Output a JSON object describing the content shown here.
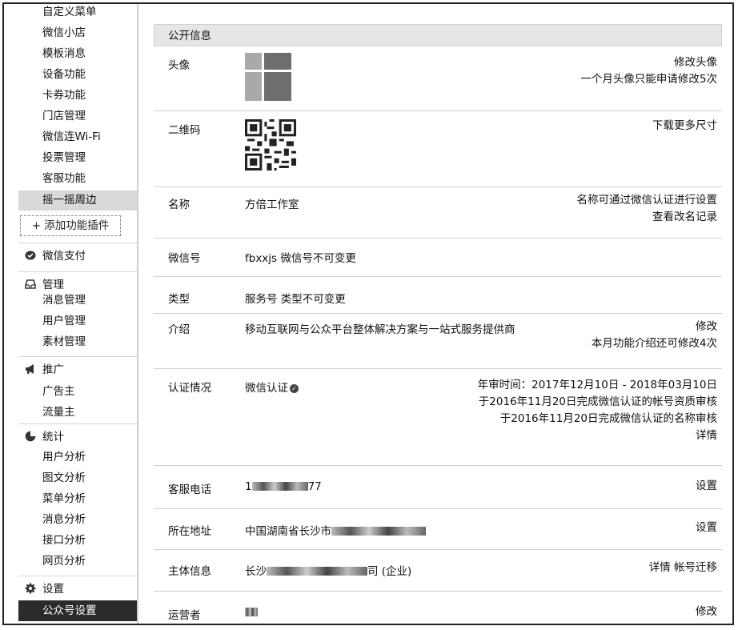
{
  "sidebar": {
    "top_items": [
      "自定义菜单",
      "微信小店",
      "模板消息",
      "设备功能",
      "卡券功能",
      "门店管理",
      "微信连Wi-Fi",
      "投票管理",
      "客服功能",
      "摇一摇周边"
    ],
    "add_plugin": "+ 添加功能插件",
    "pay": "微信支付",
    "manage": {
      "title": "管理",
      "items": [
        "消息管理",
        "用户管理",
        "素材管理"
      ]
    },
    "promote": {
      "title": "推广",
      "items": [
        "广告主",
        "流量主"
      ]
    },
    "stats": {
      "title": "统计",
      "items": [
        "用户分析",
        "图文分析",
        "菜单分析",
        "消息分析",
        "接口分析",
        "网页分析"
      ]
    },
    "settings": {
      "title": "设置",
      "items": [
        "公众号设置"
      ]
    }
  },
  "main": {
    "section_title": "公开信息",
    "avatar": {
      "label": "头像",
      "action": "修改头像",
      "note": "一个月头像只能申请修改5次"
    },
    "qrcode": {
      "label": "二维码",
      "action": "下载更多尺寸"
    },
    "name": {
      "label": "名称",
      "value": "方倍工作室",
      "action1": "名称可通过微信认证进行设置",
      "action2": "查看改名记录"
    },
    "wechat_id": {
      "label": "微信号",
      "value": "fbxxjs 微信号不可变更"
    },
    "type": {
      "label": "类型",
      "value": "服务号 类型不可变更"
    },
    "intro": {
      "label": "介绍",
      "value": "移动互联网与公众平台整体解决方案与一站式服务提供商",
      "action": "修改",
      "note": "本月功能介绍还可修改4次"
    },
    "verify": {
      "label": "认证情况",
      "value": "微信认证",
      "line1": "年审时间：2017年12月10日 - 2018年03月10日",
      "line2": "于2016年11月20日完成微信认证的帐号资质审核",
      "line3": "于2016年11月20日完成微信认证的名称审核",
      "line4": "详情"
    },
    "phone": {
      "label": "客服电话",
      "prefix": "1",
      "suffix": "77",
      "action": "设置"
    },
    "address": {
      "label": "所在地址",
      "prefix": "中国湖南省长沙市",
      "action": "设置"
    },
    "entity": {
      "label": "主体信息",
      "prefix": "长沙",
      "suffix": "司 (企业)",
      "action1": "详情",
      "action2": "帐号迁移"
    },
    "operator": {
      "label": "运营者",
      "action": "修改"
    }
  }
}
